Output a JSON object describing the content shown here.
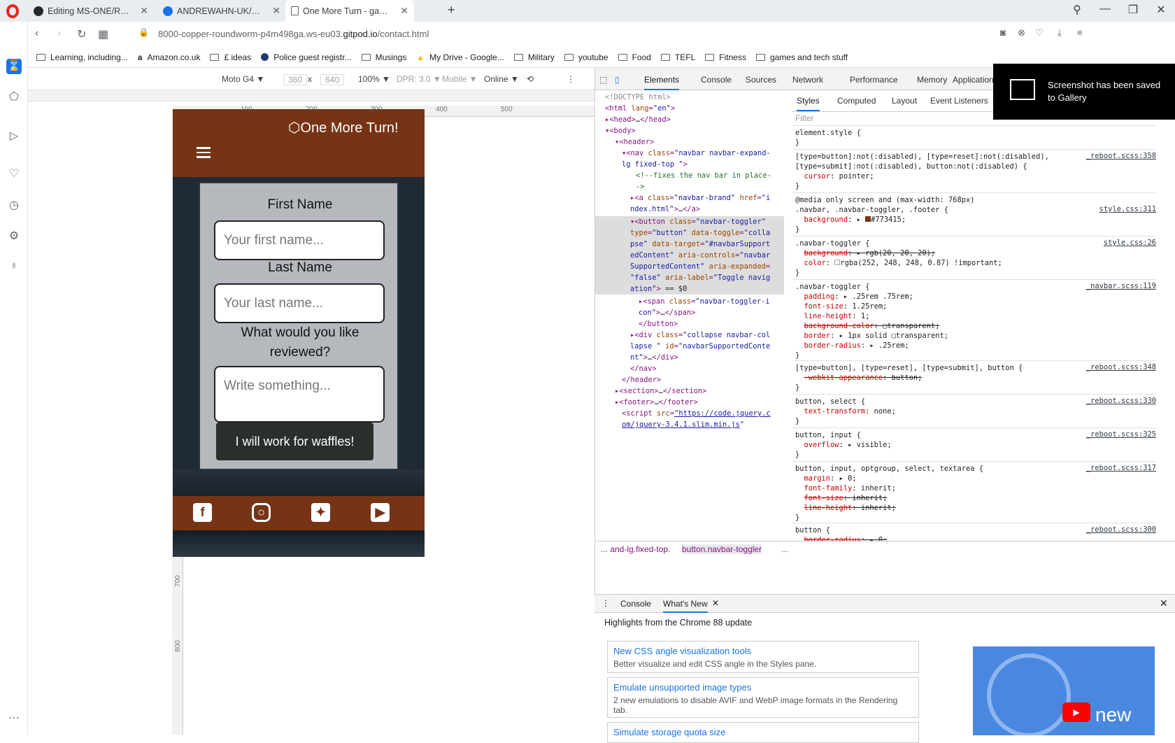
{
  "browser": {
    "tabs": [
      {
        "title": "Editing MS-ONE/README.m",
        "icon": "github-icon"
      },
      {
        "title": "ANDREWAHN-UK/MS-ONE",
        "icon": "github-icon"
      },
      {
        "title": "One More Turn - game rev",
        "icon": "page-icon"
      }
    ],
    "url_host": "8000-copper-roundworm-p4m498ga.ws-eu03.",
    "url_domain": "gitpod.io",
    "url_path": "/contact.html",
    "bookmarks": [
      {
        "label": "Learning, including..."
      },
      {
        "label": "Amazon.co.uk"
      },
      {
        "label": "£ ideas"
      },
      {
        "label": "Police guest registr..."
      },
      {
        "label": "Musings"
      },
      {
        "label": "My Drive - Google..."
      },
      {
        "label": "Military"
      },
      {
        "label": "youtube"
      },
      {
        "label": "Food"
      },
      {
        "label": "TEFL"
      },
      {
        "label": "Fitness"
      },
      {
        "label": "games and tech stuff"
      }
    ]
  },
  "device_toolbar": {
    "device": "Moto G4 ▼",
    "width": "360",
    "times": "x",
    "height": "640",
    "zoom": "100% ▼",
    "dpr": "DPR: 3.0 ▼",
    "mobile": "Mobile ▼",
    "network": "Online ▼"
  },
  "rulers": {
    "h": [
      "100",
      "200",
      "300",
      "400",
      "500"
    ],
    "v": [
      "100",
      "200",
      "300",
      "400",
      "500",
      "600",
      "700",
      "800"
    ]
  },
  "site": {
    "brand": "One More Turn!",
    "first_name_label": "First Name",
    "first_name_placeholder": "Your first name...",
    "last_name_label": "Last Name",
    "last_name_placeholder": "Your last name...",
    "review_label": "What would you like reviewed?",
    "review_placeholder": "Write something...",
    "submit_label": "I will work for waffles!",
    "header_color": "#773415"
  },
  "devtools": {
    "tabs": [
      "Elements",
      "Console",
      "Sources",
      "Network",
      "Performance",
      "Memory",
      "Application"
    ],
    "style_tabs": [
      "Styles",
      "Computed",
      "Layout",
      "Event Listeners"
    ],
    "filter_placeholder": "Filter",
    "breadcrumb": [
      "... and-lg.fixed-top.",
      "button.navbar-toggler",
      "..."
    ],
    "drawer_tabs": [
      "Console",
      "What's New"
    ],
    "drawer_heading": "Highlights from the Chrome 88 update",
    "whats_new": [
      {
        "title": "New CSS angle visualization tools",
        "desc": "Better visualize and edit CSS angle in the Styles pane."
      },
      {
        "title": "Emulate unsupported image types",
        "desc": "2 new emulations to disable AVIF and WebP image formats in the Rendering tab."
      },
      {
        "title": "Simulate storage quota size",
        "desc": ""
      }
    ],
    "video_text": "new"
  },
  "toast": {
    "text": "Screenshot has been saved to Gallery"
  }
}
